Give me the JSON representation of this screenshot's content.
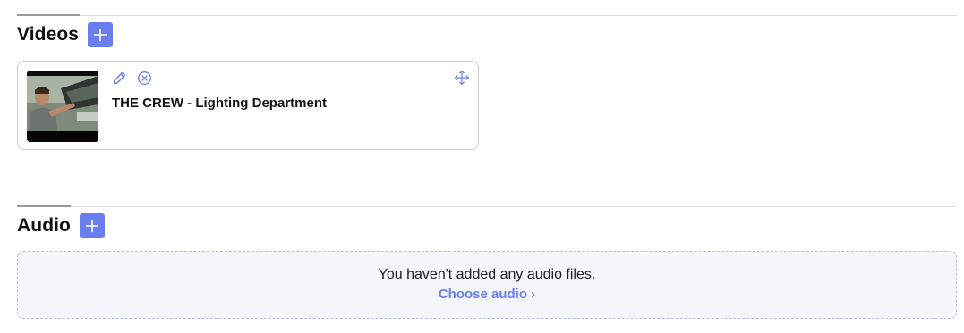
{
  "videos": {
    "title": "Videos",
    "add_icon": "plus-icon",
    "items": [
      {
        "title": "THE CREW - Lighting Department",
        "edit_icon": "pencil-icon",
        "remove_icon": "close-circle-icon",
        "move_icon": "move-arrows-icon"
      }
    ]
  },
  "audio": {
    "title": "Audio",
    "add_icon": "plus-icon",
    "empty_message": "You haven't added any audio files.",
    "choose_link": "Choose audio ›"
  },
  "colors": {
    "accent": "#6b7ef0",
    "empty_bg": "#f6f7fd",
    "empty_border": "#b9bde8"
  }
}
